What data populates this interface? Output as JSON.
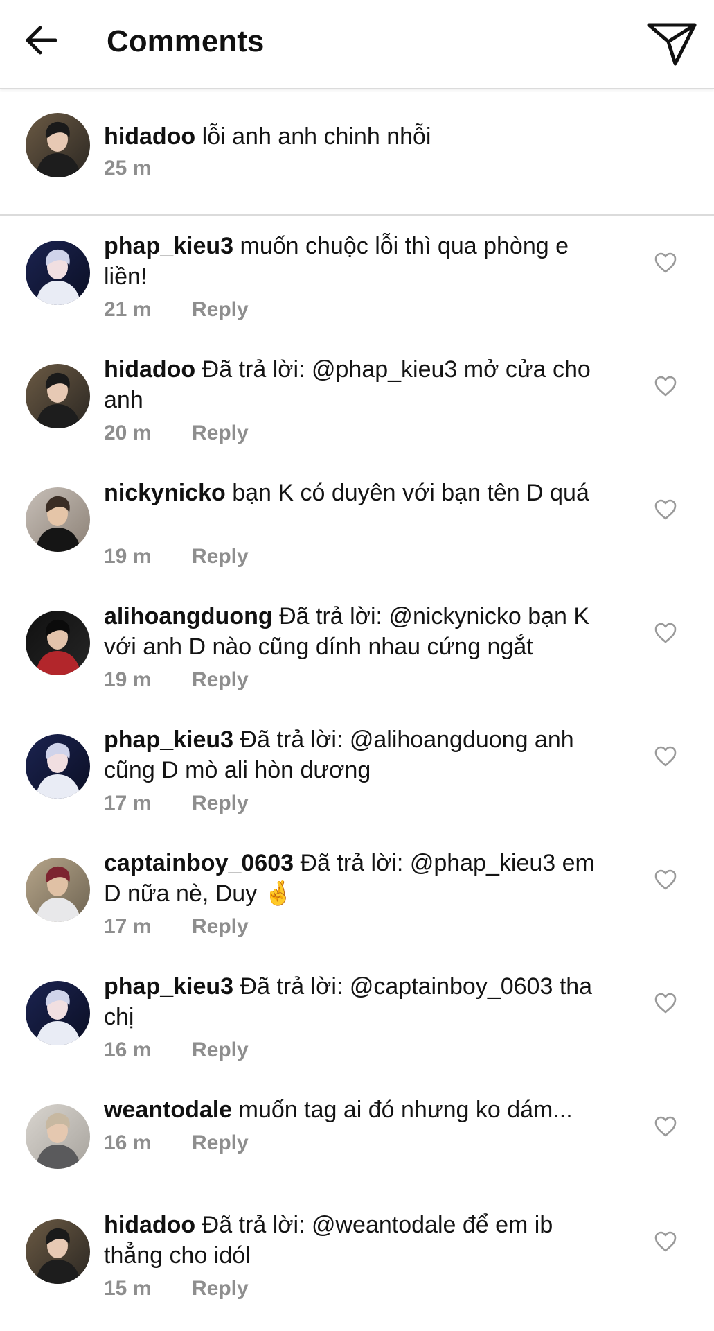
{
  "header": {
    "title": "Comments",
    "back_icon": "arrow-left-icon",
    "send_icon": "paper-plane-icon"
  },
  "caption": {
    "username": "hidadoo",
    "text": "lỗi anh anh chinh nhỗi",
    "time": "25 m"
  },
  "reply_label": "Reply",
  "colors": {
    "text": "#111111",
    "secondary": "#8e8e8e",
    "divider": "#dbdbdb"
  },
  "comments": [
    {
      "username": "phap_kieu3",
      "text": "muốn chuộc lỗi thì qua phòng e liền!",
      "time": "21 m"
    },
    {
      "username": "hidadoo",
      "text": "Đã trả lời: @phap_kieu3 mở cửa cho anh",
      "time": "20 m"
    },
    {
      "username": "nickynicko",
      "text": "bạn K có duyên với bạn tên D quá",
      "time": "19 m"
    },
    {
      "username": "alihoangduong",
      "text": "Đã trả lời: @nickynicko bạn K với anh D nào cũng dính nhau cứng ngắt",
      "time": "19 m"
    },
    {
      "username": "phap_kieu3",
      "text": "Đã trả lời: @alihoangduong anh cũng D mò ali hòn dương",
      "time": "17 m"
    },
    {
      "username": "captainboy_0603",
      "text": "Đã trả lời: @phap_kieu3 em D nữa nè, Duy 🤞",
      "time": "17 m"
    },
    {
      "username": "phap_kieu3",
      "text": "Đã trả lời: @captainboy_0603 tha chị",
      "time": "16 m"
    },
    {
      "username": "weantodale",
      "text": "muốn tag ai đó nhưng ko dám...",
      "time": "16 m"
    },
    {
      "username": "hidadoo",
      "text": "Đã trả lời: @weantodale để em ib thẳng cho idól",
      "time": "15 m"
    }
  ]
}
